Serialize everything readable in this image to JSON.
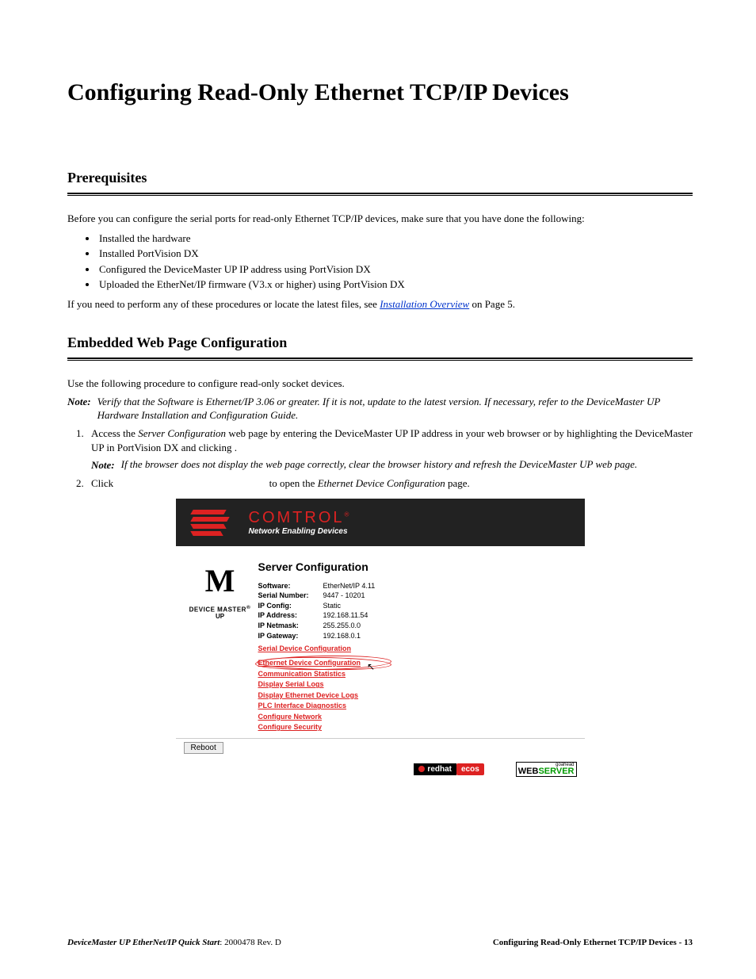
{
  "main_title": "Configuring Read-Only Ethernet TCP/IP Devices",
  "prereq": {
    "title": "Prerequisites",
    "intro": "Before you can configure the serial ports for read-only Ethernet TCP/IP devices, make sure that you have done the following:",
    "bullets": [
      "Installed the hardware",
      "Installed PortVision DX",
      "Configured the DeviceMaster UP IP address using PortVision DX",
      "Uploaded the EtherNet/IP firmware (V3.x or higher) using PortVision DX"
    ],
    "after_text_pre": "If you need to perform any of these procedures or locate the latest files, see ",
    "after_link": "Installation Overview",
    "after_text_post": " on Page 5."
  },
  "embed": {
    "title": "Embedded Web Page Configuration",
    "intro": "Use the following procedure to configure read-only socket devices.",
    "note_label": "Note:",
    "note1": "Verify that the Software is Ethernet/IP 3.06 or greater. If it is not, update to the latest version. If necessary, refer to the DeviceMaster UP Hardware Installation and Configuration Guide.",
    "step1_pre": "Access the ",
    "step1_em": "Server Configuration",
    "step1_post": " web page by entering the DeviceMaster UP IP address in your web browser or by highlighting the DeviceMaster UP in PortVision DX and clicking ",
    "step1_after": ".",
    "step1_note": "If the browser does not display the web page correctly, clear the browser history and refresh the DeviceMaster UP web page.",
    "step2_pre": "Click ",
    "step2_mid": " to open the ",
    "step2_em": "Ethernet Device Configuration",
    "step2_post": " page."
  },
  "screenshot": {
    "brand_main": "COMTROL",
    "brand_reg": "®",
    "brand_sub": "Network Enabling Devices",
    "dm_label1": "DEVICE MASTER",
    "dm_reg": "®",
    "dm_label2": "UP",
    "sc_title": "Server Configuration",
    "info": [
      {
        "label": "Software:",
        "value": "EtherNet/IP 4.11"
      },
      {
        "label": "Serial Number:",
        "value": "9447 - 10201"
      },
      {
        "label": "IP Config:",
        "value": "Static"
      },
      {
        "label": "IP Address:",
        "value": "192.168.11.54"
      },
      {
        "label": "IP Netmask:",
        "value": "255.255.0.0"
      },
      {
        "label": "IP Gateway:",
        "value": "192.168.0.1"
      }
    ],
    "links": [
      "Serial Device Configuration",
      "Ethernet Device Configuration",
      "Communication Statistics",
      "Display Serial Logs",
      "Display Ethernet Device Logs",
      "PLC Interface Diagnostics",
      "Configure Network",
      "Configure Security"
    ],
    "reboot": "Reboot",
    "redhat": "redhat",
    "ecos": "ecos",
    "ws_top": "goahead",
    "ws_web": "WEB",
    "ws_server": "SERVER"
  },
  "footer": {
    "doc_title": "DeviceMaster UP EtherNet/IP Quick Start",
    "doc_rev": ": 2000478 Rev. D",
    "right": "Configuring Read-Only Ethernet TCP/IP Devices - 13"
  }
}
